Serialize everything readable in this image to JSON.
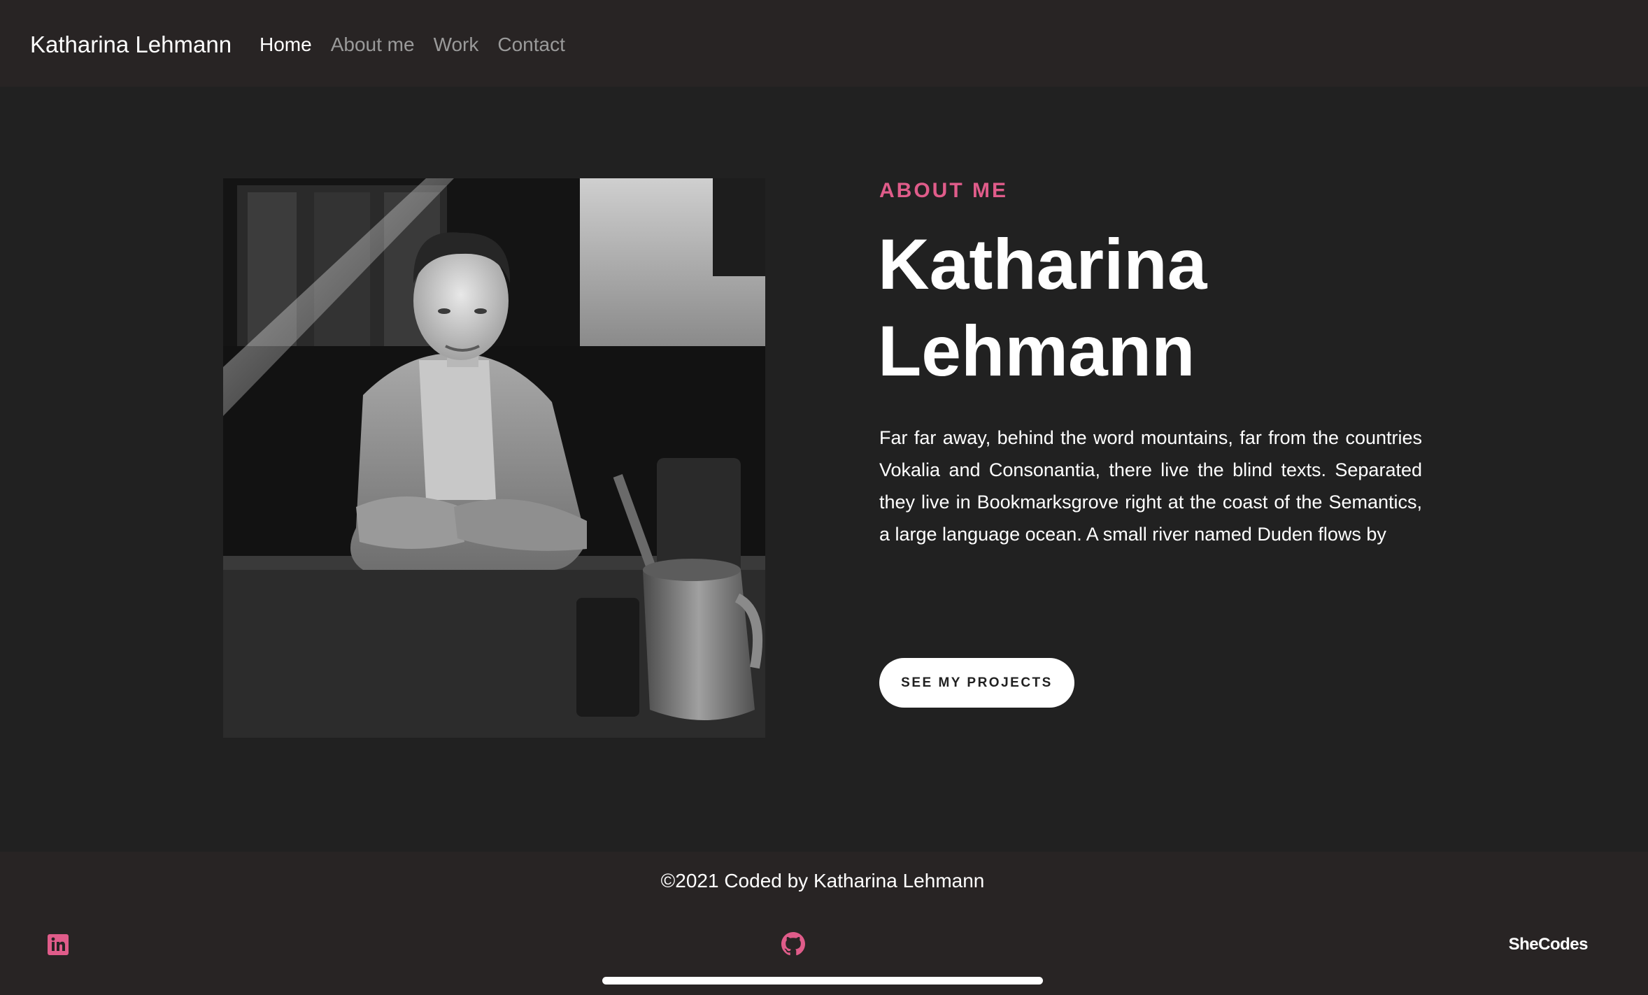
{
  "header": {
    "brand": "Katharina Lehmann",
    "nav": [
      "Home",
      "About me",
      "Work",
      "Contact"
    ],
    "active": "Home"
  },
  "hero": {
    "eyebrow": "ABOUT ME",
    "name_line1": "Katharina",
    "name_line2": "Lehmann",
    "bio": "Far far away, behind the word mountains, far from the countries Vokalia and Consonantia, there live the blind texts. Separated they live in Bookmarksgrove right at the coast of the Semantics, a large language ocean. A small river named Duden flows by",
    "button_label": "SEE MY PROJECTS"
  },
  "footer": {
    "copyright": "©2021 Coded by Katharina Lehmann",
    "shecodes": "SheCodes"
  },
  "icons": {
    "linkedin": "linkedin-icon",
    "github": "github-icon"
  },
  "colors": {
    "accent": "#e05c8a",
    "background": "#212121",
    "bars": "#282424",
    "text": "#ffffff",
    "muted_nav": "#9a9a9a"
  }
}
